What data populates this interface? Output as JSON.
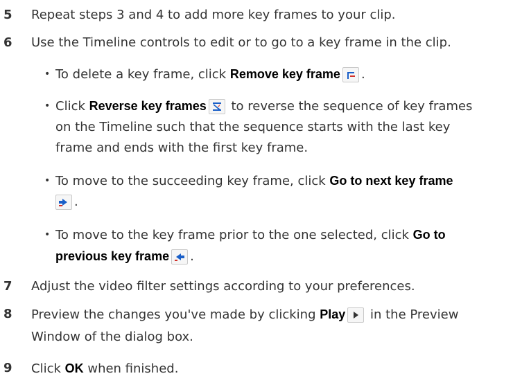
{
  "steps": [
    {
      "num": "5",
      "text": "Repeat steps 3 and 4 to add more key frames to your clip."
    },
    {
      "num": "6",
      "text": "Use the Timeline controls to edit or to go to a key frame in the clip."
    },
    {
      "num": "7",
      "text": "Adjust the video filter settings according to your preferences."
    },
    {
      "num": "8",
      "pre": "Preview the changes you've made by clicking ",
      "bold": "Play",
      "post1": " in the Preview",
      "post2": "Window of the dialog box."
    },
    {
      "num": "9",
      "pre": "Click ",
      "bold": "OK",
      "post": " when finished."
    }
  ],
  "bullets": [
    {
      "pre": "To delete a key frame, click ",
      "bold": "Remove key frame",
      "post": "."
    },
    {
      "pre": "Click ",
      "bold": "Reverse key frames",
      "line1_post": " to reverse the sequence of key frames",
      "line2": "on the Timeline such that the sequence starts with the last key",
      "line3": "frame and ends with the first key frame."
    },
    {
      "pre": "To move to the succeeding key frame, click ",
      "bold": "Go to next key frame",
      "post": "."
    },
    {
      "pre": "To move to the key frame prior to the one selected, click ",
      "bold1": "Go to",
      "bold2": "previous key frame",
      "post": "."
    }
  ],
  "icons": {
    "remove": "remove-keyframe-icon",
    "reverse": "reverse-keyframes-icon",
    "next": "next-keyframe-icon",
    "previous": "previous-keyframe-icon",
    "play": "play-icon"
  },
  "colors": {
    "text": "#333333",
    "bold": "#000000",
    "icon_blue": "#1a5fc8",
    "icon_red": "#d0302a"
  }
}
